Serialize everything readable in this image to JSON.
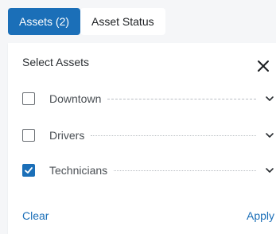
{
  "tabs": [
    {
      "label": "Assets (2)",
      "active": true
    },
    {
      "label": "Asset Status",
      "active": false
    }
  ],
  "panel": {
    "title": "Select Assets",
    "close_icon": "close-icon",
    "items": [
      {
        "label": "Downtown",
        "checked": false
      },
      {
        "label": "Drivers",
        "checked": false
      },
      {
        "label": "Technicians",
        "checked": true
      }
    ],
    "clear_label": "Clear",
    "apply_label": "Apply"
  },
  "colors": {
    "accent": "#1b6fb8",
    "background": "#f5f6f8",
    "panel": "#ffffff"
  }
}
